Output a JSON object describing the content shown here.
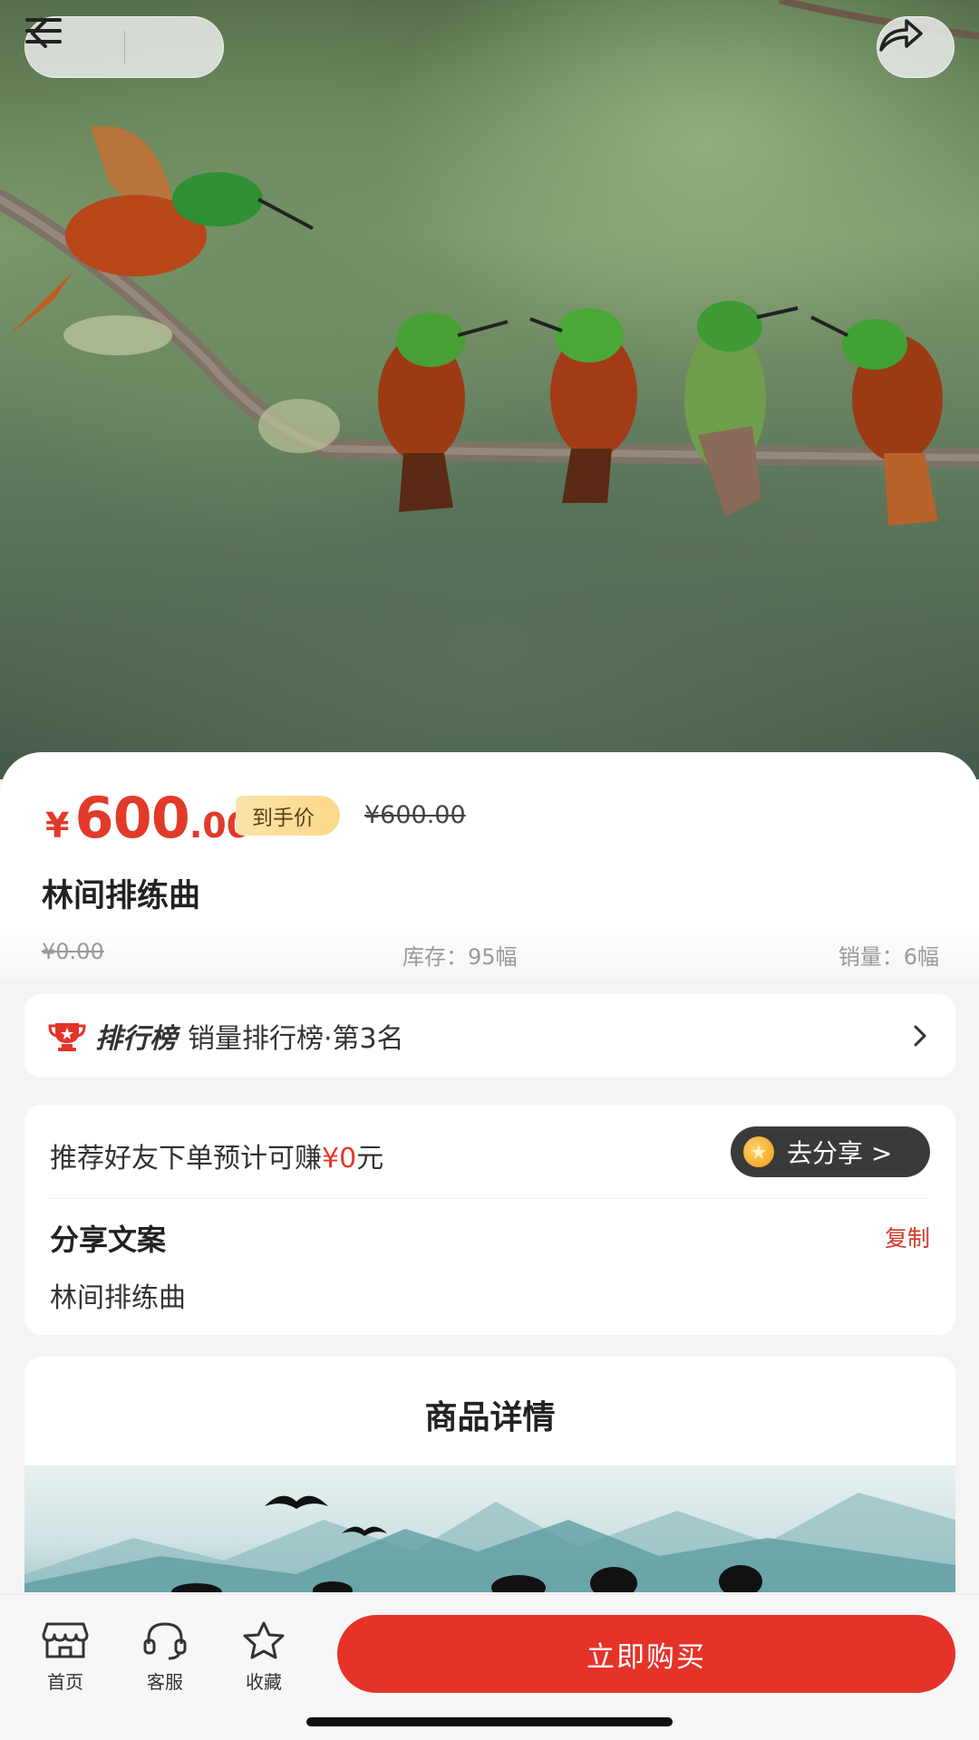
{
  "nav": {
    "back_icon": "chevron-left-icon",
    "menu_icon": "hamburger-menu-icon",
    "share_icon": "share-arrow-icon"
  },
  "product": {
    "currency": "¥",
    "price_int": "600",
    "price_dec": ".00",
    "badge": "到手价",
    "original_price": "¥600.00",
    "title": "林间排练曲",
    "meta_price": "¥0.00",
    "stock": "库存：95幅",
    "sales": "销量：6幅"
  },
  "ranking": {
    "logo_text": "排行榜",
    "text": "销量排行榜·第3名",
    "icon": "trophy-icon"
  },
  "share": {
    "recommend_prefix": "推荐好友下单预计可赚",
    "recommend_amount": "¥0",
    "recommend_suffix": "元",
    "go_share": "去分享 >",
    "copy_title": "分享文案",
    "copy_button": "复制",
    "copy_body": "林间排练曲"
  },
  "detail": {
    "title": "商品详情"
  },
  "bottom_bar": {
    "items": [
      {
        "label": "首页",
        "icon": "store-icon"
      },
      {
        "label": "客服",
        "icon": "headset-icon"
      },
      {
        "label": "收藏",
        "icon": "star-icon"
      }
    ],
    "buy_label": "立即购买"
  },
  "colors": {
    "accent_red": "#e23a2a",
    "buy_button": "#e5332a",
    "badge_gold": "#fbd98a"
  }
}
